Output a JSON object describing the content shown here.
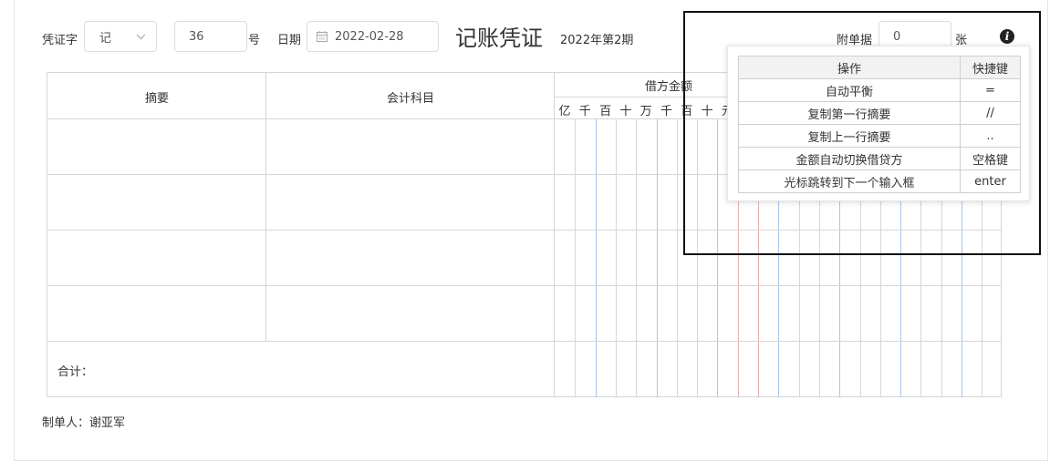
{
  "header": {
    "voucher_word_label": "凭证字",
    "voucher_word_value": "记",
    "voucher_number": "36",
    "number_suffix": "号",
    "date_label": "日期",
    "date_value": "2022-02-28",
    "title": "记账凭证",
    "period": "2022年第2期",
    "attachments_label": "附单据",
    "attachments_value": "0",
    "attachments_unit": "张"
  },
  "grid": {
    "col_summary": "摘要",
    "col_account": "会计科目",
    "col_debit": "借方金额",
    "digit_labels": [
      "亿",
      "千",
      "百",
      "十",
      "万",
      "千",
      "百",
      "十",
      "元"
    ],
    "total_label": "合计："
  },
  "footer": {
    "maker_label": "制单人：",
    "maker_name": "谢亚军"
  },
  "shortcuts": {
    "col_action": "操作",
    "col_key": "快捷键",
    "rows": [
      {
        "action": "自动平衡",
        "key": "="
      },
      {
        "action": "复制第一行摘要",
        "key": "//"
      },
      {
        "action": "复制上一行摘要",
        "key": ".."
      },
      {
        "action": "金额自动切换借贷方",
        "key": "空格键"
      },
      {
        "action": "光标跳转到下一个输入框",
        "key": "enter"
      }
    ]
  },
  "colors": {
    "border": "#d6d6d6",
    "digit_line_blue": "#a8c8e8",
    "digit_line_red": "#e8b0b0"
  }
}
